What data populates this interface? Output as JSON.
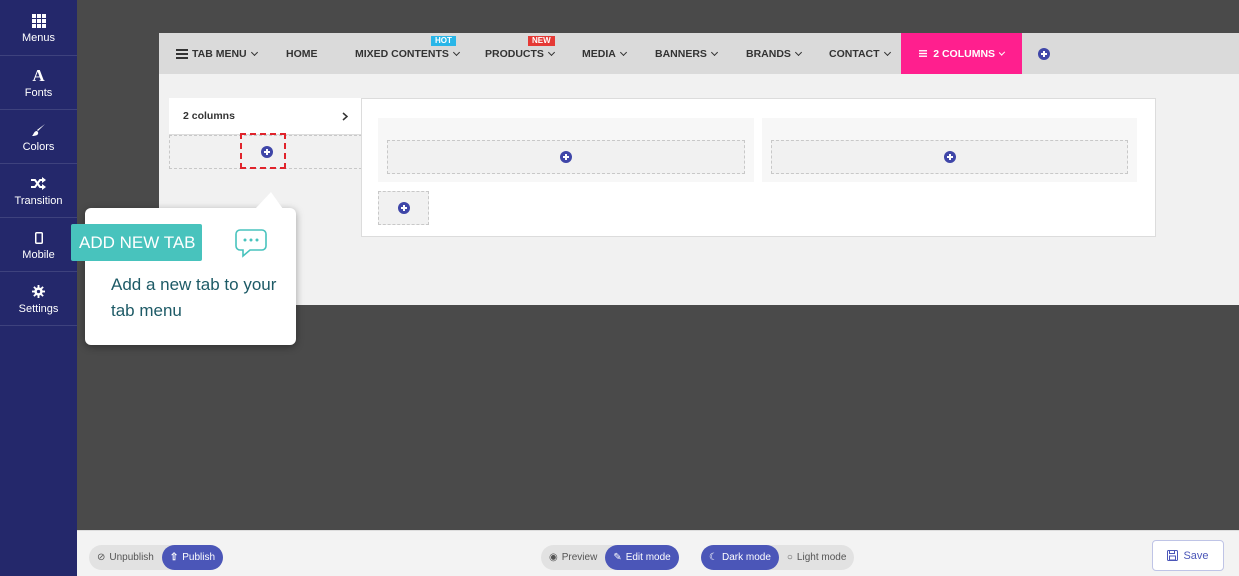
{
  "sidebar": {
    "items": [
      {
        "label": "Menus",
        "icon": "grid-icon"
      },
      {
        "label": "Fonts",
        "icon": "font-icon"
      },
      {
        "label": "Colors",
        "icon": "brush-icon"
      },
      {
        "label": "Transition",
        "icon": "shuffle-icon"
      },
      {
        "label": "Mobile",
        "icon": "mobile-icon"
      },
      {
        "label": "Settings",
        "icon": "gear-icon"
      }
    ]
  },
  "menubar": {
    "tab_menu": "TAB MENU",
    "home": "HOME",
    "mixed_contents": "MIXED CONTENTS",
    "hot_badge": "HOT",
    "products": "PRODUCTS",
    "new_badge": "NEW",
    "media": "MEDIA",
    "banners": "BANNERS",
    "brands": "BRANDS",
    "contact": "CONTACT",
    "active_tab": "2 COLUMNS"
  },
  "tabs_panel": {
    "tab_label": "2 columns"
  },
  "tooltip": {
    "title": "ADD NEW TAB",
    "body": "Add a new tab to your tab menu"
  },
  "bottombar": {
    "unpublish": "Unpublish",
    "publish": "Publish",
    "preview": "Preview",
    "edit_mode": "Edit mode",
    "dark_mode": "Dark mode",
    "light_mode": "Light mode",
    "save": "Save"
  },
  "colors": {
    "sidebar_bg": "#24286b",
    "accent": "#4b56b8",
    "active_tab": "#ff1f8e",
    "tooltip_head": "#48c3bd",
    "hot_badge": "#29b6e8",
    "new_badge": "#e53935",
    "highlight": "#e0242c"
  }
}
